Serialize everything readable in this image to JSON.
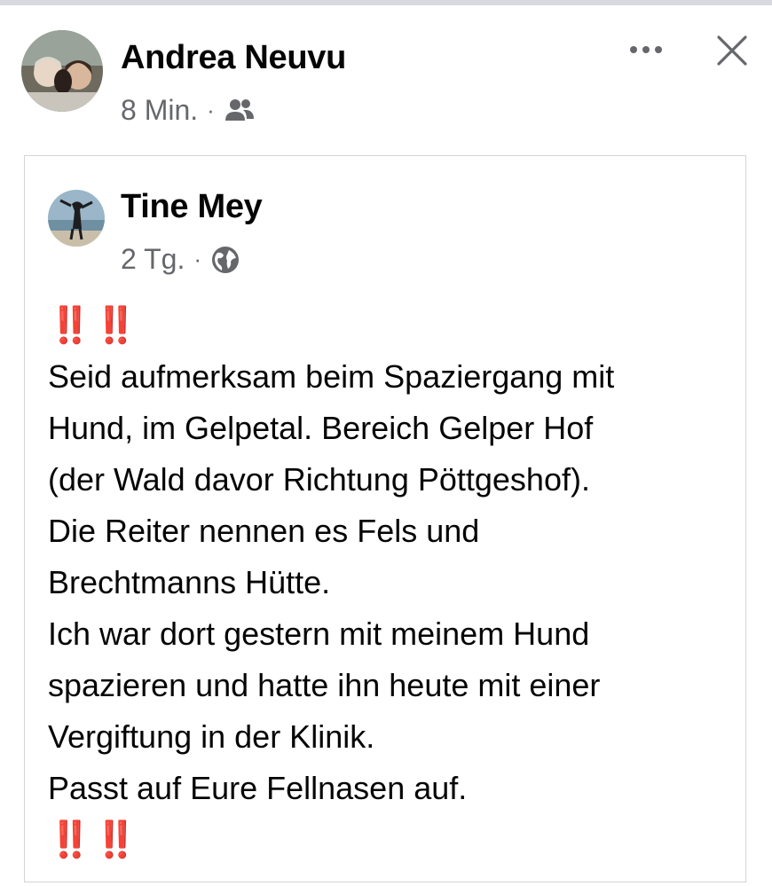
{
  "sharer": {
    "name": "Andrea Neuvu",
    "time": "8 Min.",
    "audience_icon": "friends-icon"
  },
  "header_actions": {
    "more_icon": "more-horizontal-icon",
    "close_icon": "close-icon"
  },
  "shared_post": {
    "author": {
      "name": "Tine Mey",
      "time": "2 Tg.",
      "audience_icon": "globe-icon"
    },
    "marks_top": "‼️‼️",
    "lines": [
      "Seid aufmerksam beim Spaziergang mit",
      "Hund, im Gelpetal. Bereich Gelper Hof",
      "(der Wald davor Richtung Pöttgeshof).",
      "Die Reiter nennen es Fels und",
      "Brechtmanns Hütte.",
      "Ich war dort gestern mit meinem Hund",
      "spazieren und hatte ihn heute mit einer",
      "Vergiftung in der Klinik.",
      "Passt auf Eure Fellnasen auf."
    ],
    "marks_bottom": "‼️‼️"
  },
  "colors": {
    "text": "#050505",
    "secondary": "#65676b",
    "alert_red": "#e4131b",
    "border": "#d2d4d8"
  }
}
